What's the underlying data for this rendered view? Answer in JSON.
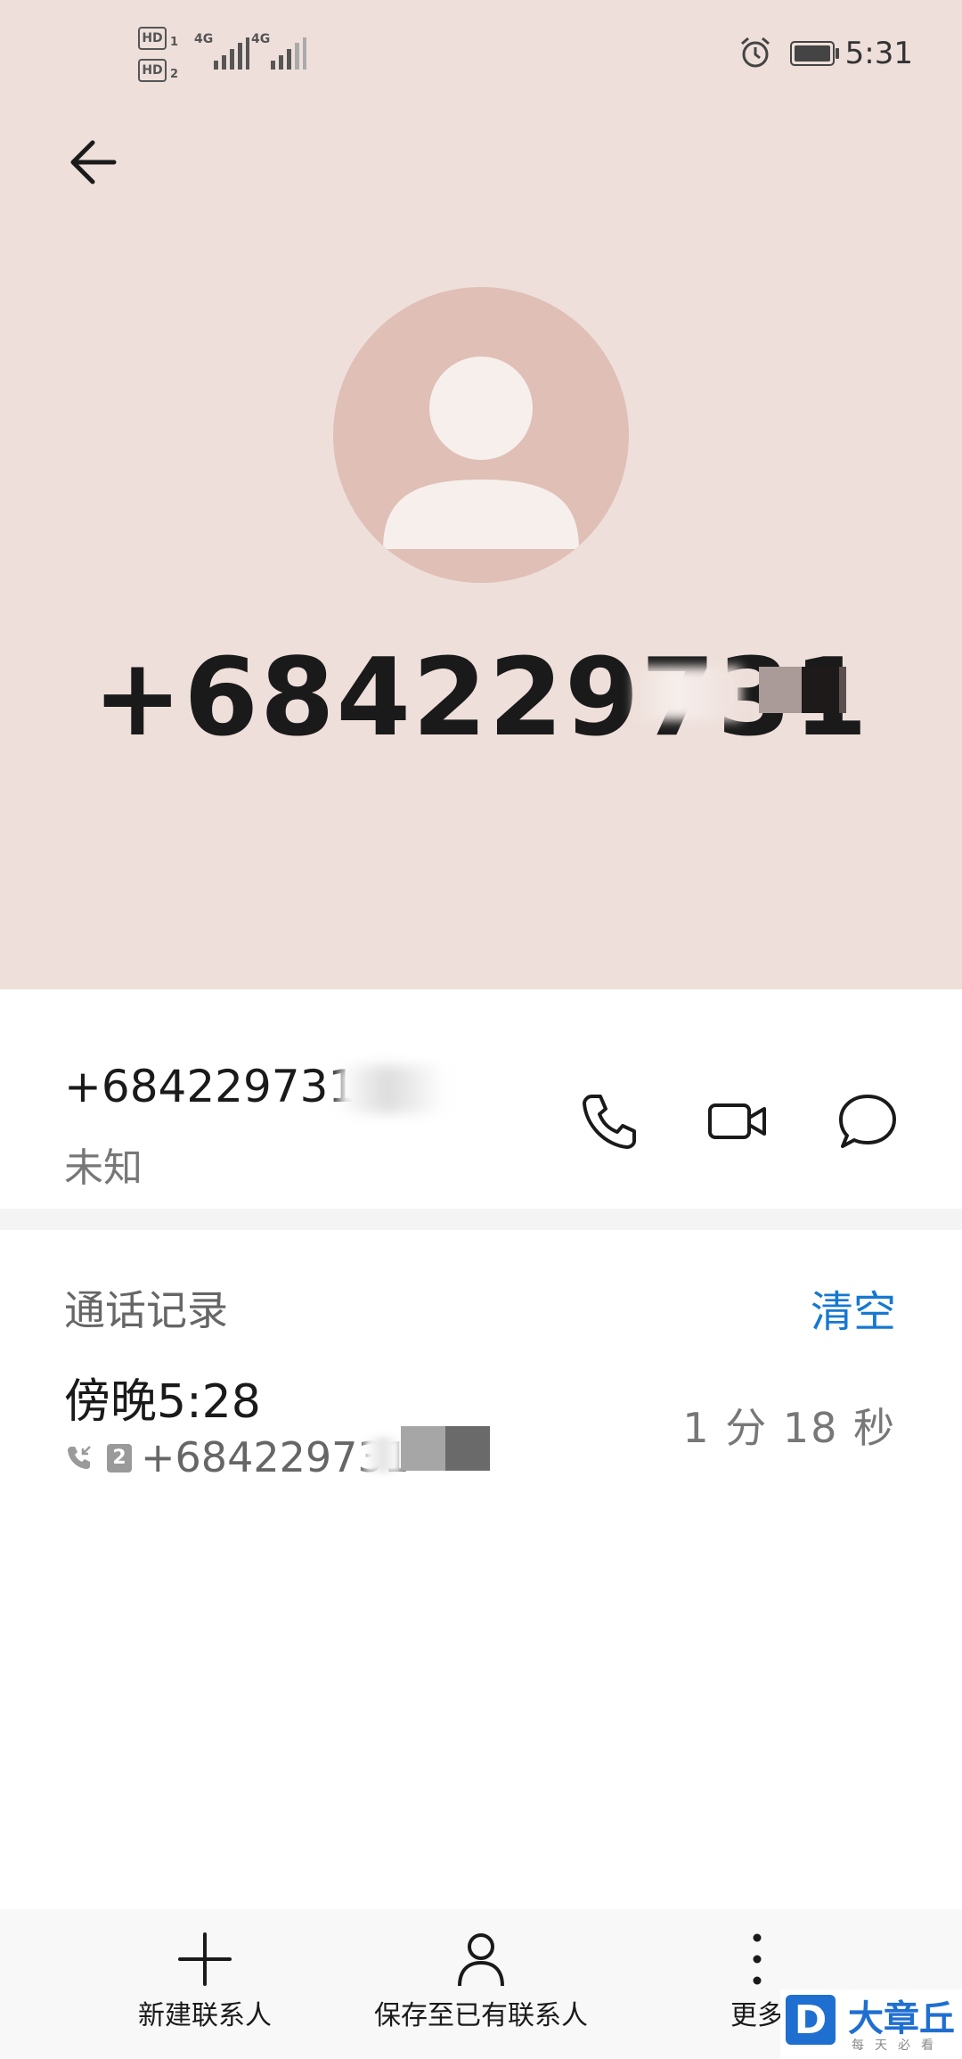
{
  "status_bar": {
    "hd1": "HD",
    "hd2": "HD",
    "sim1": "1",
    "sim2": "2",
    "net1": "4G",
    "net2": "4G",
    "time": "5:31"
  },
  "contact": {
    "display_number": "+684229731",
    "number": "+684229731",
    "label": "未知"
  },
  "call_log": {
    "title": "通话记录",
    "clear_label": "清空",
    "records": [
      {
        "time": "傍晚5:28",
        "sim": "2",
        "number": "+684229731",
        "duration": "1 分 18 秒"
      }
    ]
  },
  "bottom_bar": {
    "new_contact": "新建联系人",
    "save_existing": "保存至已有联系人",
    "more": "更多"
  },
  "watermark": {
    "logo_letter": "D",
    "title": "大章丘",
    "subtitle": "每天必看"
  },
  "colors": {
    "hero_bg": "#eedfda",
    "avatar_bg": "#dfbfb6",
    "accent": "#1678d0"
  }
}
